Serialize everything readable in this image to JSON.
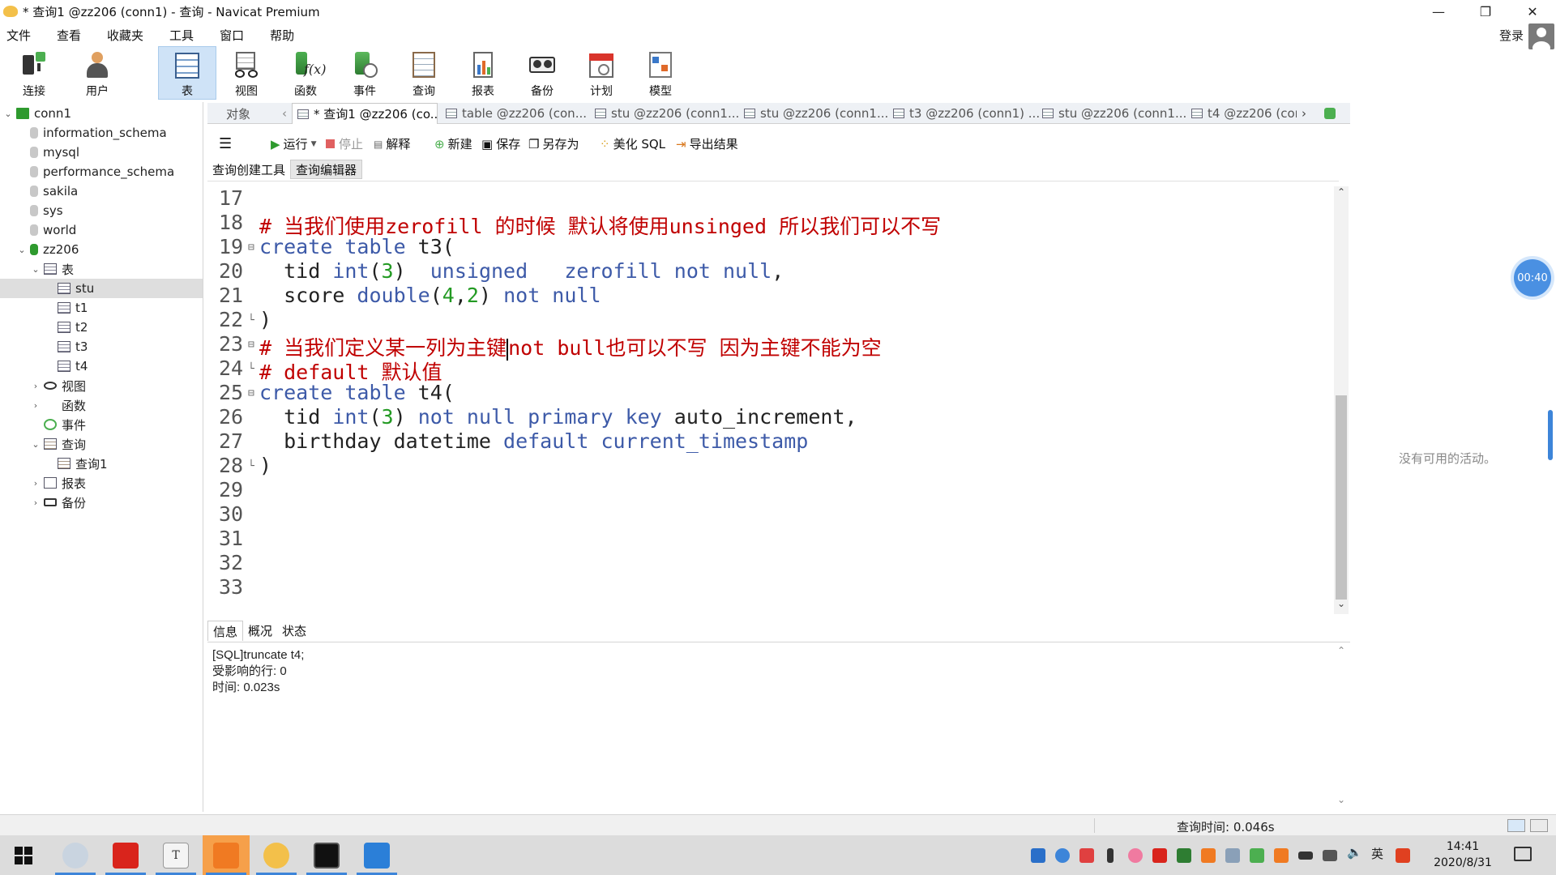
{
  "window": {
    "title": "* 查询1 @zz206 (conn1) - 查询 - Navicat Premium",
    "min": "—",
    "restore": "❐",
    "close": "✕"
  },
  "menu": {
    "items": [
      "文件",
      "查看",
      "收藏夹",
      "工具",
      "窗口",
      "帮助"
    ],
    "login": "登录"
  },
  "toolbar": {
    "connect": "连接",
    "user": "用户",
    "table": "表",
    "view": "视图",
    "function": "函数",
    "event": "事件",
    "query": "查询",
    "report": "报表",
    "backup": "备份",
    "schedule": "计划",
    "model": "模型"
  },
  "tree": [
    {
      "label": "conn1",
      "level": 0,
      "arrow": "⌄",
      "icon": "connection-icon"
    },
    {
      "label": "information_schema",
      "level": 1,
      "arrow": "",
      "icon": "database-icon"
    },
    {
      "label": "mysql",
      "level": 1,
      "arrow": "",
      "icon": "database-icon"
    },
    {
      "label": "performance_schema",
      "level": 1,
      "arrow": "",
      "icon": "database-icon"
    },
    {
      "label": "sakila",
      "level": 1,
      "arrow": "",
      "icon": "database-icon"
    },
    {
      "label": "sys",
      "level": 1,
      "arrow": "",
      "icon": "database-icon"
    },
    {
      "label": "world",
      "level": 1,
      "arrow": "",
      "icon": "database-icon"
    },
    {
      "label": "zz206",
      "level": 1,
      "arrow": "⌄",
      "icon": "database-open-icon"
    },
    {
      "label": "表",
      "level": 2,
      "arrow": "⌄",
      "icon": "table-icon"
    },
    {
      "label": "stu",
      "level": 3,
      "arrow": "",
      "icon": "table-icon",
      "selected": true
    },
    {
      "label": "t1",
      "level": 3,
      "arrow": "",
      "icon": "table-icon"
    },
    {
      "label": "t2",
      "level": 3,
      "arrow": "",
      "icon": "table-icon"
    },
    {
      "label": "t3",
      "level": 3,
      "arrow": "",
      "icon": "table-icon"
    },
    {
      "label": "t4",
      "level": 3,
      "arrow": "",
      "icon": "table-icon"
    },
    {
      "label": "视图",
      "level": 2,
      "arrow": "›",
      "icon": "view-icon"
    },
    {
      "label": "函数",
      "level": 2,
      "arrow": "›",
      "icon": "function-icon"
    },
    {
      "label": "事件",
      "level": 2,
      "arrow": "",
      "icon": "event-icon"
    },
    {
      "label": "查询",
      "level": 2,
      "arrow": "⌄",
      "icon": "query-icon"
    },
    {
      "label": "查询1",
      "level": 3,
      "arrow": "",
      "icon": "query-icon"
    },
    {
      "label": "报表",
      "level": 2,
      "arrow": "›",
      "icon": "report-icon"
    },
    {
      "label": "备份",
      "level": 2,
      "arrow": "›",
      "icon": "backup-icon"
    }
  ],
  "tabs": {
    "objects": "对象",
    "items": [
      "* 查询1 @zz206 (co...",
      "table @zz206 (con...",
      "stu @zz206 (conn1...",
      "stu @zz206 (conn1...",
      "t3 @zz206 (conn1) ...",
      "stu @zz206 (conn1...",
      "t4 @zz206 (cor"
    ]
  },
  "query_toolbar": {
    "menu": "☰",
    "run": "运行",
    "stop": "停止",
    "explain": "解释",
    "new": "新建",
    "save": "保存",
    "save_as": "另存为",
    "beautify": "美化 SQL",
    "export": "导出结果"
  },
  "subtabs": [
    "查询创建工具",
    "查询编辑器"
  ],
  "editor": {
    "lines": [
      {
        "n": "17",
        "fold": "",
        "tokens": []
      },
      {
        "n": "18",
        "fold": "",
        "tokens": [
          {
            "t": "# 当我们使用zerofill 的时候 默认将使用unsinged 所以我们可以不写",
            "c": "c-red"
          }
        ]
      },
      {
        "n": "19",
        "fold": "⊟",
        "tokens": [
          {
            "t": "create table ",
            "c": "c-kw"
          },
          {
            "t": "t3(",
            "c": "c-id"
          }
        ]
      },
      {
        "n": "20",
        "fold": "",
        "tokens": [
          {
            "t": "  tid ",
            "c": "c-id"
          },
          {
            "t": "int",
            "c": "c-kw"
          },
          {
            "t": "(",
            "c": "c-id"
          },
          {
            "t": "3",
            "c": "c-num"
          },
          {
            "t": ")  ",
            "c": "c-id"
          },
          {
            "t": "unsigned   zerofill not null",
            "c": "c-kw"
          },
          {
            "t": ",",
            "c": "c-id"
          }
        ]
      },
      {
        "n": "21",
        "fold": "",
        "tokens": [
          {
            "t": "  score ",
            "c": "c-id"
          },
          {
            "t": "double",
            "c": "c-kw"
          },
          {
            "t": "(",
            "c": "c-id"
          },
          {
            "t": "4",
            "c": "c-num"
          },
          {
            "t": ",",
            "c": "c-id"
          },
          {
            "t": "2",
            "c": "c-num"
          },
          {
            "t": ") ",
            "c": "c-id"
          },
          {
            "t": "not null",
            "c": "c-kw"
          }
        ]
      },
      {
        "n": "22",
        "fold": "└",
        "tokens": [
          {
            "t": ")",
            "c": "c-id"
          }
        ]
      },
      {
        "n": "23",
        "fold": "⊟",
        "tokens": [
          {
            "t": "# 当我们定义某一列为主键",
            "c": "c-red"
          },
          {
            "t": "|",
            "c": "cursor"
          },
          {
            "t": "not bull也可以不写 因为主键不能为空",
            "c": "c-red"
          }
        ]
      },
      {
        "n": "24",
        "fold": "└",
        "tokens": [
          {
            "t": "# default 默认值",
            "c": "c-red"
          }
        ]
      },
      {
        "n": "25",
        "fold": "⊟",
        "tokens": [
          {
            "t": "create table ",
            "c": "c-kw"
          },
          {
            "t": "t4(",
            "c": "c-id"
          }
        ]
      },
      {
        "n": "26",
        "fold": "",
        "tokens": [
          {
            "t": "  tid ",
            "c": "c-id"
          },
          {
            "t": "int",
            "c": "c-kw"
          },
          {
            "t": "(",
            "c": "c-id"
          },
          {
            "t": "3",
            "c": "c-num"
          },
          {
            "t": ") ",
            "c": "c-id"
          },
          {
            "t": "not null primary key",
            "c": "c-kw"
          },
          {
            "t": " auto_increment,",
            "c": "c-id"
          }
        ]
      },
      {
        "n": "27",
        "fold": "",
        "tokens": [
          {
            "t": "  birthday datetime ",
            "c": "c-id"
          },
          {
            "t": "default current_timestamp",
            "c": "c-kw"
          }
        ]
      },
      {
        "n": "28",
        "fold": "└",
        "tokens": [
          {
            "t": ")",
            "c": "c-id"
          }
        ]
      },
      {
        "n": "29",
        "fold": "",
        "tokens": []
      },
      {
        "n": "30",
        "fold": "",
        "tokens": []
      },
      {
        "n": "31",
        "fold": "",
        "tokens": []
      },
      {
        "n": "32",
        "fold": "",
        "tokens": []
      },
      {
        "n": "33",
        "fold": "",
        "tokens": []
      }
    ]
  },
  "bottom_tabs": [
    "信息",
    "概况",
    "状态"
  ],
  "messages": [
    "[SQL]truncate t4;",
    "受影响的行: 0",
    "时间: 0.023s"
  ],
  "right_panel": {
    "no_activity": "没有可用的活动。",
    "timer": "00:40"
  },
  "status": {
    "query_time": "查询时间: 0.046s"
  },
  "taskbar": {
    "time": "14:41",
    "date": "2020/8/31",
    "ime": "英"
  },
  "colors": {
    "accent": "#3d85d9",
    "comment": "#c00000",
    "keyword": "#3d5aa8",
    "number": "#239a23"
  }
}
